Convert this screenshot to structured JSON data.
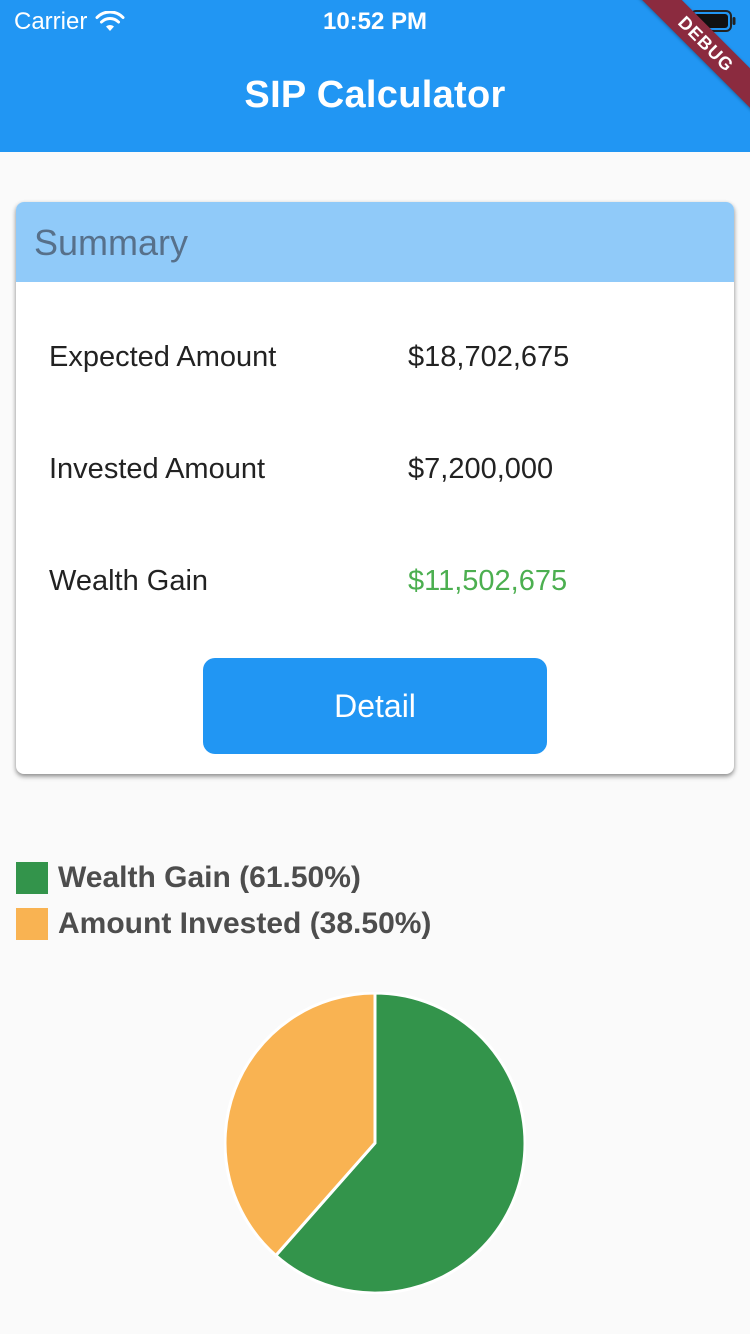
{
  "status_bar": {
    "carrier": "Carrier",
    "time": "10:52 PM"
  },
  "app_bar": {
    "title": "SIP Calculator",
    "debug_label": "DEBUG",
    "color": "#2196f3"
  },
  "summary": {
    "title": "Summary",
    "rows": [
      {
        "label": "Expected Amount",
        "value": "$18,702,675"
      },
      {
        "label": "Invested Amount",
        "value": "$7,200,000"
      },
      {
        "label": "Wealth Gain",
        "value": "$11,502,675"
      }
    ],
    "detail_label": "Detail",
    "header_color": "#90caf9",
    "gain_color": "#4caf50"
  },
  "legend": [
    {
      "text": "Wealth Gain (61.50%)",
      "color": "#33944b"
    },
    {
      "text": "Amount Invested (38.50%)",
      "color": "#f9b352"
    }
  ],
  "chart_data": {
    "type": "pie",
    "slices": [
      {
        "name": "Wealth Gain",
        "value": 61.5,
        "color": "#33944b"
      },
      {
        "name": "Amount Invested",
        "value": 38.5,
        "color": "#f9b352"
      }
    ]
  }
}
